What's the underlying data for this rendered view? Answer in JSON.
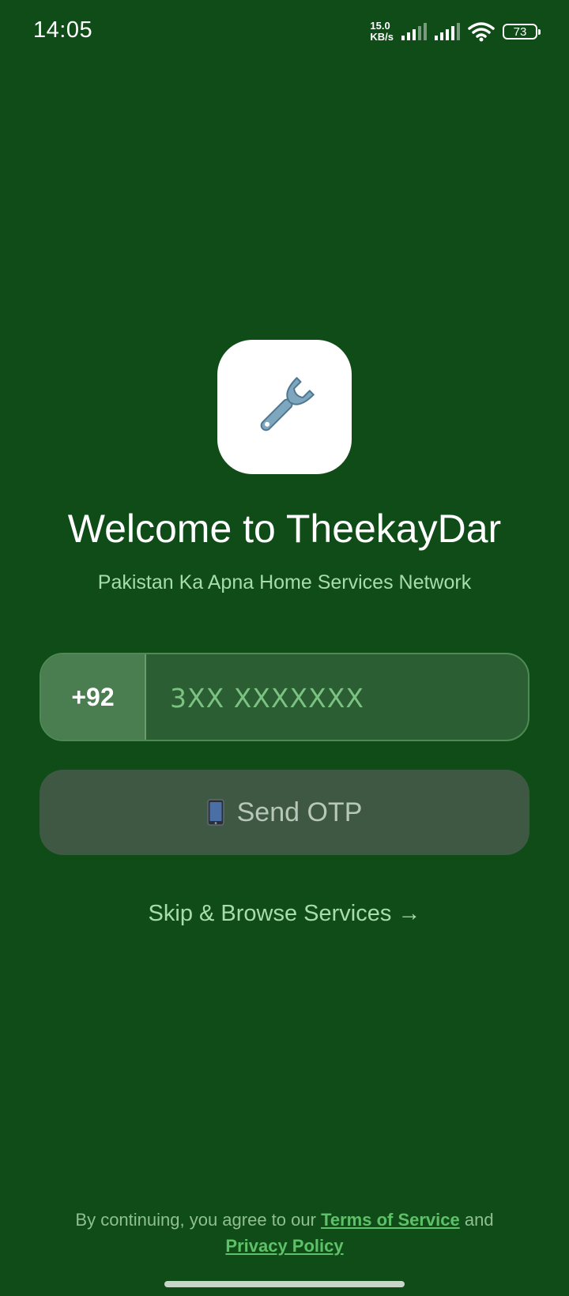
{
  "status_bar": {
    "time": "14:05",
    "net_speed_value": "15.0",
    "net_speed_unit": "KB/s",
    "battery": "73"
  },
  "logo": {
    "icon": "wrench-icon"
  },
  "welcome": {
    "title": "Welcome to TheekayDar",
    "subtitle": "Pakistan Ka Apna Home Services Network"
  },
  "phone": {
    "country_code": "+92",
    "placeholder": "3XX XXXXXXX",
    "value": ""
  },
  "send_otp": {
    "label": "Send OTP",
    "icon": "mobile-phone-icon"
  },
  "skip": {
    "label": "Skip & Browse Services →"
  },
  "footer": {
    "prefix": "By continuing, you agree to our",
    "terms": "Terms of Service",
    "joiner": "and",
    "privacy": "Privacy Policy"
  },
  "colors": {
    "background": "#0f4c17",
    "accent": "#5fc06a",
    "subtitle": "#a8dcaa",
    "button_disabled": "#3e5844"
  }
}
